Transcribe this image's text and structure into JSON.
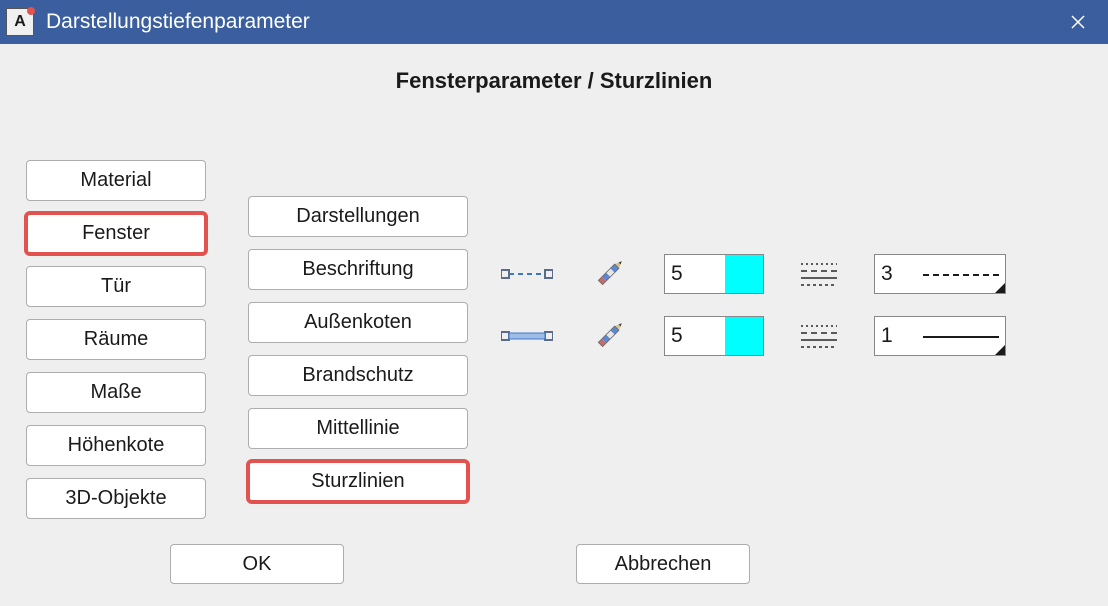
{
  "window": {
    "title": "Darstellungstiefenparameter",
    "app_icon_letter": "A"
  },
  "heading": "Fensterparameter / Sturzlinien",
  "left_tabs": [
    {
      "label": "Material",
      "selected": false
    },
    {
      "label": "Fenster",
      "selected": true
    },
    {
      "label": "Tür",
      "selected": false
    },
    {
      "label": "Räume",
      "selected": false
    },
    {
      "label": "Maße",
      "selected": false
    },
    {
      "label": "Höhenkote",
      "selected": false
    },
    {
      "label": "3D-Objekte",
      "selected": false
    }
  ],
  "sub_tabs": [
    {
      "label": "Darstellungen",
      "selected": false
    },
    {
      "label": "Beschriftung",
      "selected": false
    },
    {
      "label": "Außenkoten",
      "selected": false
    },
    {
      "label": "Brandschutz",
      "selected": false
    },
    {
      "label": "Mittellinie",
      "selected": false
    },
    {
      "label": "Sturzlinien",
      "selected": true
    }
  ],
  "rows": [
    {
      "symbol": "lintel-dashed",
      "color_value": "5",
      "color_hex": "#00ffff",
      "linetype_value": "3",
      "linetype_style": "dashed"
    },
    {
      "symbol": "lintel-solid",
      "color_value": "5",
      "color_hex": "#00ffff",
      "linetype_value": "1",
      "linetype_style": "solid"
    }
  ],
  "buttons": {
    "ok": "OK",
    "cancel": "Abbrechen"
  }
}
